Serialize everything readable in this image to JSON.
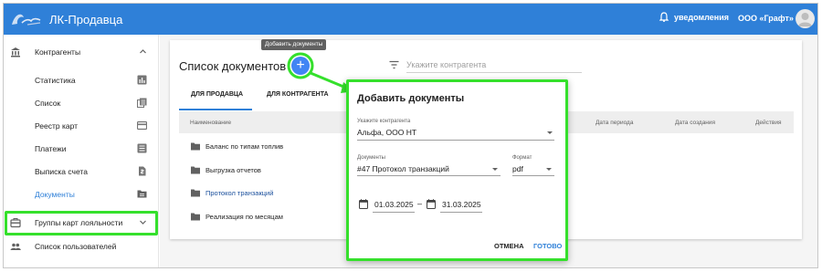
{
  "app": {
    "title": "ЛК-Продавца"
  },
  "topbar": {
    "notifications_label": "уведомления",
    "organization": "ООО «Графт»"
  },
  "sidebar": {
    "items": [
      {
        "label": "Контрагенты",
        "icon": "bank-icon",
        "expanded": true
      },
      {
        "label": "Статистика",
        "icon": "bar-chart-icon"
      },
      {
        "label": "Список",
        "icon": "copy-list-icon"
      },
      {
        "label": "Реестр карт",
        "icon": "credit-card-icon"
      },
      {
        "label": "Платежи",
        "icon": "list-lines-icon"
      },
      {
        "label": "Выписка счета",
        "icon": "file-currency-icon"
      },
      {
        "label": "Документы",
        "icon": "folder-icon",
        "active": true
      },
      {
        "label": "Группы карт лояльности",
        "icon": "card-group-icon",
        "expanded": false
      },
      {
        "label": "Список пользователей",
        "icon": "users-icon"
      }
    ]
  },
  "page": {
    "title": "Список документов",
    "add_tooltip": "Добавить документы",
    "filter_placeholder": "Укажите контрагента",
    "tabs": [
      "ДЛЯ ПРОДАВЦА",
      "ДЛЯ КОНТРАГЕНТА"
    ],
    "active_tab": 0,
    "columns": [
      "Наименование",
      "Дата периода",
      "Дата создания",
      "Действия"
    ],
    "rows": [
      {
        "name": "Баланс по типам топлив",
        "link": false
      },
      {
        "name": "Выгрузка отчетов",
        "link": false
      },
      {
        "name": "Протокол транзакций",
        "link": true
      },
      {
        "name": "Реализация по месяцам",
        "link": false
      }
    ]
  },
  "dialog": {
    "title": "Добавить документы",
    "contractor_label": "Укажите контрагента",
    "contractor_value": "Альфа, ООО НТ",
    "documents_label": "Документы",
    "documents_value": "#47 Протокол транзакций",
    "format_label": "Формат",
    "format_value": "pdf",
    "date_from": "01.03.2025",
    "date_sep": "–",
    "date_to": "31.03.2025",
    "cancel_label": "ОТМЕНА",
    "ok_label": "ГОТОВО"
  },
  "colors": {
    "primary": "#2f80d8",
    "highlight": "#35e02c",
    "fab": "#4285f4"
  }
}
